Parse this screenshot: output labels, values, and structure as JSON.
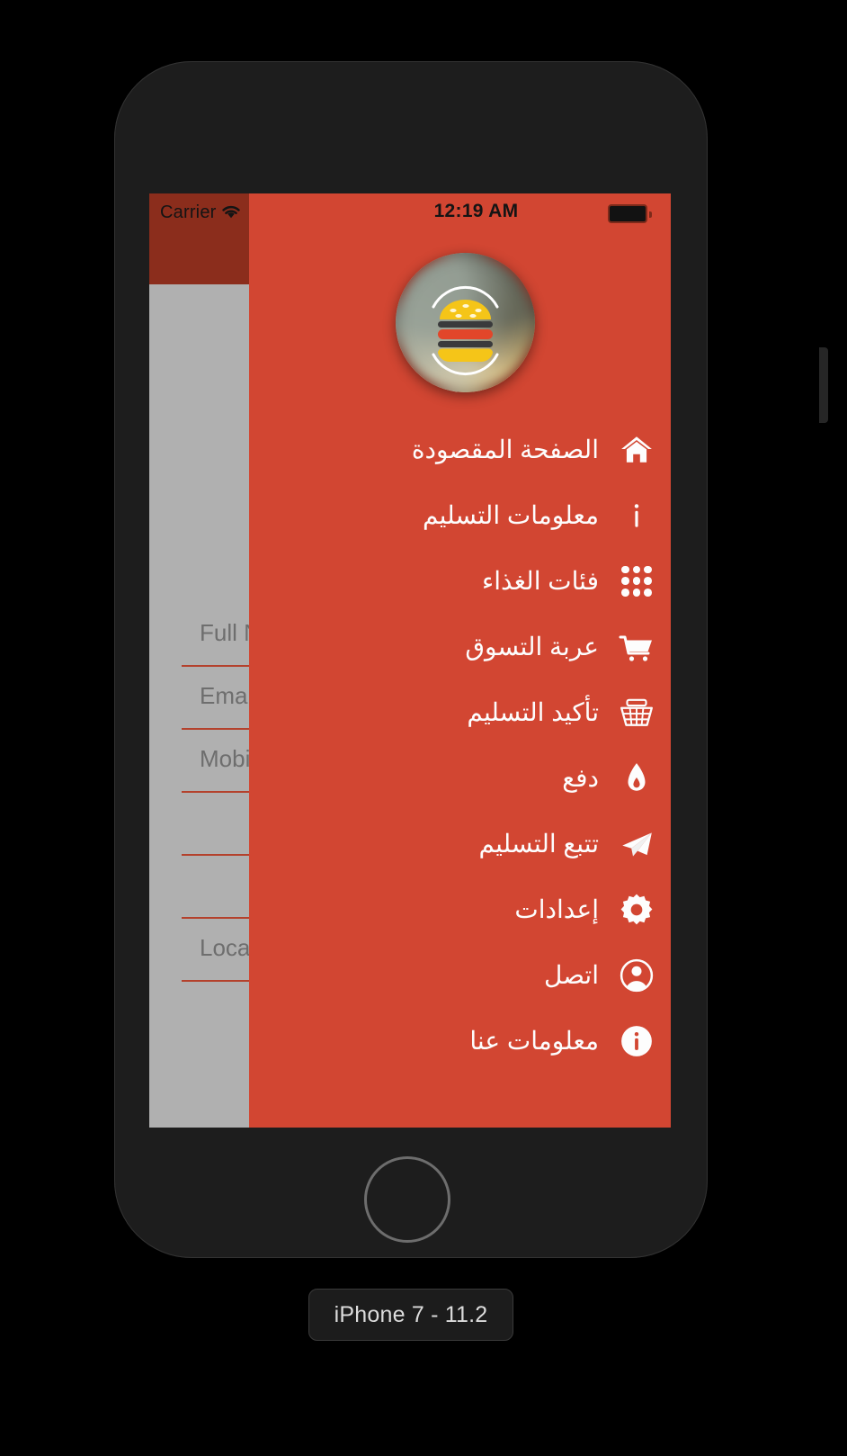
{
  "simulator": {
    "device_chip_label": "iPhone 7 - 11.2"
  },
  "status_bar": {
    "carrier": "Carrier",
    "wifi_icon": "wifi-icon",
    "time": "12:19 AM",
    "battery_icon": "battery-icon"
  },
  "drawer": {
    "background_color": "#d24632",
    "status_strip_color": "#8b2d1c",
    "logo": {
      "icon": "burger-logo-icon",
      "alt": "burger-logo"
    },
    "items": [
      {
        "label": "الصفحة المقصودة",
        "icon": "home-icon"
      },
      {
        "label": "معلومات التسليم",
        "icon": "info-letter-icon"
      },
      {
        "label": "فئات الغذاء",
        "icon": "grid-dots-icon"
      },
      {
        "label": "عربة التسوق",
        "icon": "shopping-cart-icon"
      },
      {
        "label": "تأكيد التسليم",
        "icon": "basket-icon"
      },
      {
        "label": "دفع",
        "icon": "flame-icon"
      },
      {
        "label": "تتبع التسليم",
        "icon": "paper-plane-icon"
      },
      {
        "label": "إعدادات",
        "icon": "gear-icon"
      },
      {
        "label": "اتصل",
        "icon": "user-circle-icon"
      },
      {
        "label": "معلومات عنا",
        "icon": "info-circle-icon"
      }
    ]
  },
  "form_behind": {
    "background_color": "#b0b0b0",
    "underline_color": "#b4412c",
    "fields": [
      {
        "placeholder": "Full Name"
      },
      {
        "placeholder": "Email"
      },
      {
        "placeholder": "Mobile"
      },
      {
        "placeholder": ""
      },
      {
        "placeholder": ""
      },
      {
        "placeholder": "Location"
      }
    ]
  }
}
